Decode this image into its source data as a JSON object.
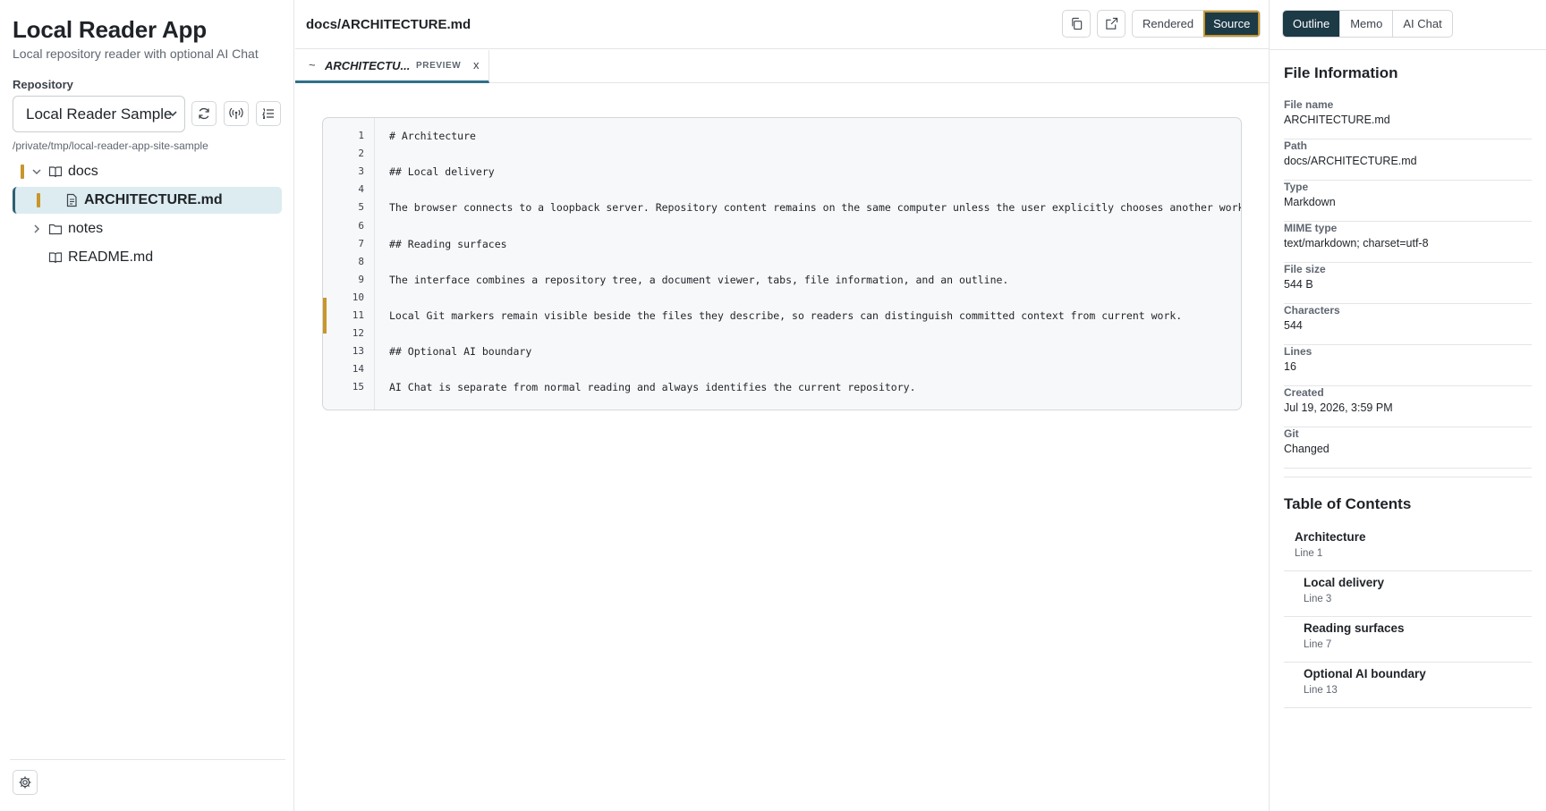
{
  "app": {
    "title": "Local Reader App",
    "subtitle": "Local repository reader with optional AI Chat"
  },
  "repository": {
    "label": "Repository",
    "selected": "Local Reader Sample",
    "path": "/private/tmp/local-reader-app-site-sample"
  },
  "tree": {
    "docs": "docs",
    "architecture": "ARCHITECTURE.md",
    "notes": "notes",
    "readme": "README.md"
  },
  "header": {
    "doc_path": "docs/ARCHITECTURE.md",
    "view_modes": [
      "Rendered",
      "Source"
    ],
    "active_view": "Source"
  },
  "tab": {
    "prefix": "~",
    "name": "ARCHITECTU...",
    "badge": "PREVIEW",
    "close": "x"
  },
  "code": {
    "lines": [
      {
        "n": "1",
        "text": "# Architecture"
      },
      {
        "n": "2",
        "text": ""
      },
      {
        "n": "3",
        "text": "## Local delivery"
      },
      {
        "n": "4",
        "text": ""
      },
      {
        "n": "5",
        "text": "The browser connects to a loopback server. Repository content remains on the same computer unless the user explicitly chooses another workflow."
      },
      {
        "n": "6",
        "text": ""
      },
      {
        "n": "7",
        "text": "## Reading surfaces"
      },
      {
        "n": "8",
        "text": ""
      },
      {
        "n": "9",
        "text": "The interface combines a repository tree, a document viewer, tabs, file information, and an outline."
      },
      {
        "n": "10",
        "text": ""
      },
      {
        "n": "11",
        "text": "Local Git markers remain visible beside the files they describe, so readers can distinguish committed context from current work."
      },
      {
        "n": "12",
        "text": ""
      },
      {
        "n": "13",
        "text": "## Optional AI boundary"
      },
      {
        "n": "14",
        "text": ""
      },
      {
        "n": "15",
        "text": "AI Chat is separate from normal reading and always identifies the current repository."
      }
    ]
  },
  "right_tabs": {
    "items": [
      "Outline",
      "Memo",
      "AI Chat"
    ],
    "active": "Outline"
  },
  "file_info": {
    "title": "File Information",
    "items": [
      {
        "key": "File name",
        "value": "ARCHITECTURE.md"
      },
      {
        "key": "Path",
        "value": "docs/ARCHITECTURE.md"
      },
      {
        "key": "Type",
        "value": "Markdown"
      },
      {
        "key": "MIME type",
        "value": "text/markdown; charset=utf-8"
      },
      {
        "key": "File size",
        "value": "544 B"
      },
      {
        "key": "Characters",
        "value": "544"
      },
      {
        "key": "Lines",
        "value": "16"
      },
      {
        "key": "Created",
        "value": "Jul 19, 2026, 3:59 PM"
      },
      {
        "key": "Git",
        "value": "Changed"
      }
    ]
  },
  "toc": {
    "title": "Table of Contents",
    "items": [
      {
        "title": "Architecture",
        "line": "Line 1"
      },
      {
        "title": "Local delivery",
        "line": "Line 3"
      },
      {
        "title": "Reading surfaces",
        "line": "Line 7"
      },
      {
        "title": "Optional AI boundary",
        "line": "Line 13"
      }
    ]
  },
  "colors": {
    "accent_dark": "#1d3a47",
    "git_marker": "#c9962b",
    "selected_row": "#dcecf0"
  }
}
